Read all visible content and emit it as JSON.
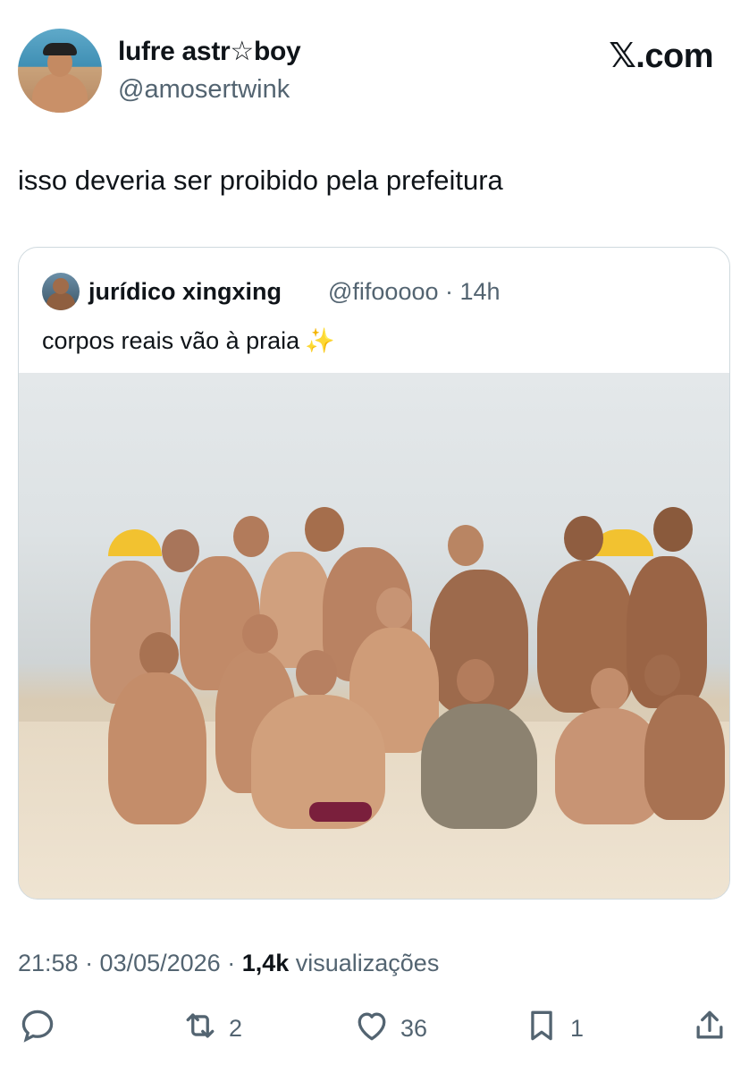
{
  "author": {
    "name": "lufre astr☆boy",
    "handle": "@amosertwink"
  },
  "brand": "𝕏.com",
  "tweet_text": "isso deveria ser proibido pela prefeitura",
  "quoted": {
    "name": "jurídico xingxing",
    "handle_time": "@fifooooo · 14h",
    "text": "corpos reais vão à praia",
    "emoji": "✨"
  },
  "meta": {
    "time_date": "21:58 · 03/05/2026 · ",
    "views_count": "1,4k",
    "views_label": " visualizações"
  },
  "actions": {
    "replies": "",
    "retweets": "2",
    "likes": "36",
    "bookmarks": "1"
  },
  "icons": [
    "reply-icon",
    "retweet-icon",
    "like-icon",
    "bookmark-icon",
    "share-icon"
  ]
}
